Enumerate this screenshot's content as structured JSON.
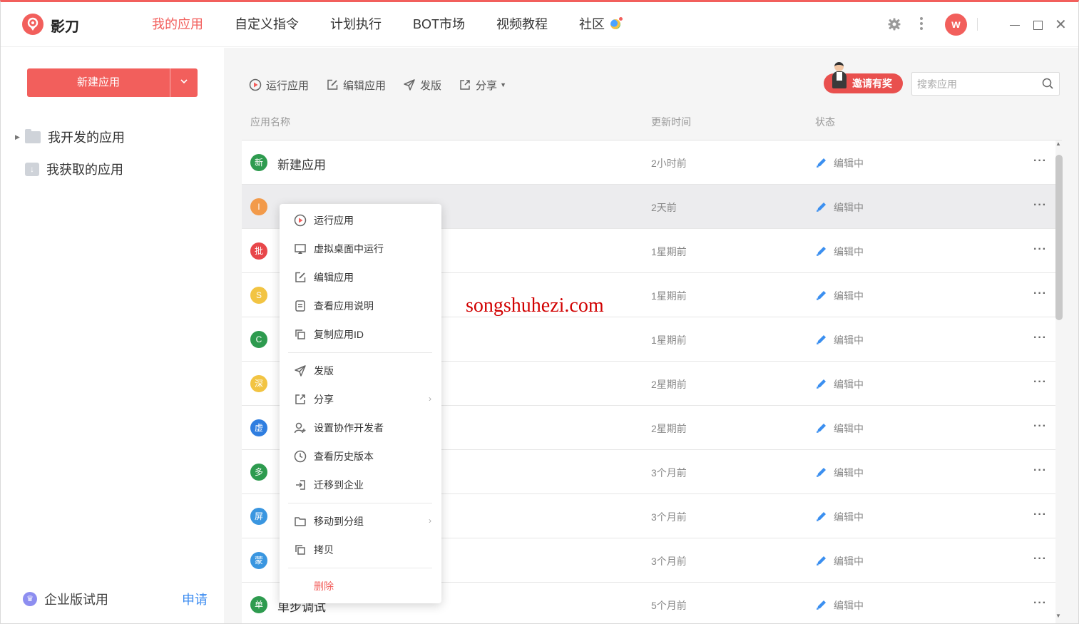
{
  "app": {
    "name": "影刀"
  },
  "nav": {
    "items": [
      {
        "label": "我的应用",
        "active": true
      },
      {
        "label": "自定义指令",
        "active": false
      },
      {
        "label": "计划执行",
        "active": false
      },
      {
        "label": "BOT市场",
        "active": false
      },
      {
        "label": "视频教程",
        "active": false
      },
      {
        "label": "社区",
        "active": false
      }
    ]
  },
  "user": {
    "avatar_letter": "w"
  },
  "sidebar": {
    "new_app_label": "新建应用",
    "items": [
      {
        "label": "我开发的应用"
      },
      {
        "label": "我获取的应用"
      }
    ],
    "enterprise_label": "企业版试用",
    "apply_label": "申请"
  },
  "toolbar": {
    "run_label": "运行应用",
    "edit_label": "编辑应用",
    "publish_label": "发版",
    "share_label": "分享",
    "invite_label": "邀请有奖"
  },
  "search": {
    "placeholder": "搜索应用"
  },
  "table": {
    "headers": {
      "name": "应用名称",
      "updated": "更新时间",
      "status": "状态"
    },
    "rows": [
      {
        "badge": "新",
        "badge_color": "#2e9b4f",
        "name": "新建应用",
        "time": "2小时前",
        "status": "编辑中"
      },
      {
        "badge": "l",
        "badge_color": "#f29a4a",
        "name": "",
        "time": "2天前",
        "status": "编辑中"
      },
      {
        "badge": "批",
        "badge_color": "#e8474a",
        "name": "",
        "time": "1星期前",
        "status": "编辑中"
      },
      {
        "badge": "S",
        "badge_color": "#f2c443",
        "name": "",
        "time": "1星期前",
        "status": "编辑中"
      },
      {
        "badge": "C",
        "badge_color": "#2e9b4f",
        "name": "",
        "time": "1星期前",
        "status": "编辑中"
      },
      {
        "badge": "深",
        "badge_color": "#f2c443",
        "name": "",
        "time": "2星期前",
        "status": "编辑中"
      },
      {
        "badge": "虚",
        "badge_color": "#2f7ee0",
        "name": "",
        "time": "2星期前",
        "status": "编辑中"
      },
      {
        "badge": "多",
        "badge_color": "#2e9b4f",
        "name": "",
        "time": "3个月前",
        "status": "编辑中"
      },
      {
        "badge": "屏",
        "badge_color": "#3a96e0",
        "name": "",
        "time": "3个月前",
        "status": "编辑中"
      },
      {
        "badge": "蒙",
        "badge_color": "#3a96e0",
        "name": "",
        "time": "3个月前",
        "status": "编辑中"
      },
      {
        "badge": "单",
        "badge_color": "#2e9b4f",
        "name": "单步调试",
        "time": "5个月前",
        "status": "编辑中"
      }
    ],
    "more_glyph": "···"
  },
  "context_menu": {
    "items": [
      {
        "label": "运行应用",
        "icon": "play-icon"
      },
      {
        "label": "虚拟桌面中运行",
        "icon": "monitor-icon"
      },
      {
        "label": "编辑应用",
        "icon": "edit-icon"
      },
      {
        "label": "查看应用说明",
        "icon": "doc-icon"
      },
      {
        "label": "复制应用ID",
        "icon": "copy-icon"
      },
      {
        "label": "发版",
        "icon": "send-icon"
      },
      {
        "label": "分享",
        "icon": "share-icon"
      },
      {
        "label": "设置协作开发者",
        "icon": "user-add-icon"
      },
      {
        "label": "查看历史版本",
        "icon": "clock-icon"
      },
      {
        "label": "迁移到企业",
        "icon": "login-icon"
      },
      {
        "label": "移动到分组",
        "icon": "folder-icon"
      },
      {
        "label": "拷贝",
        "icon": "copy-icon"
      },
      {
        "label": "删除",
        "icon": ""
      }
    ]
  },
  "watermark": "songshuhezi.com",
  "colors": {
    "accent": "#f25f5c",
    "link": "#3c8cf0",
    "pencil": "#3b8ff0"
  }
}
